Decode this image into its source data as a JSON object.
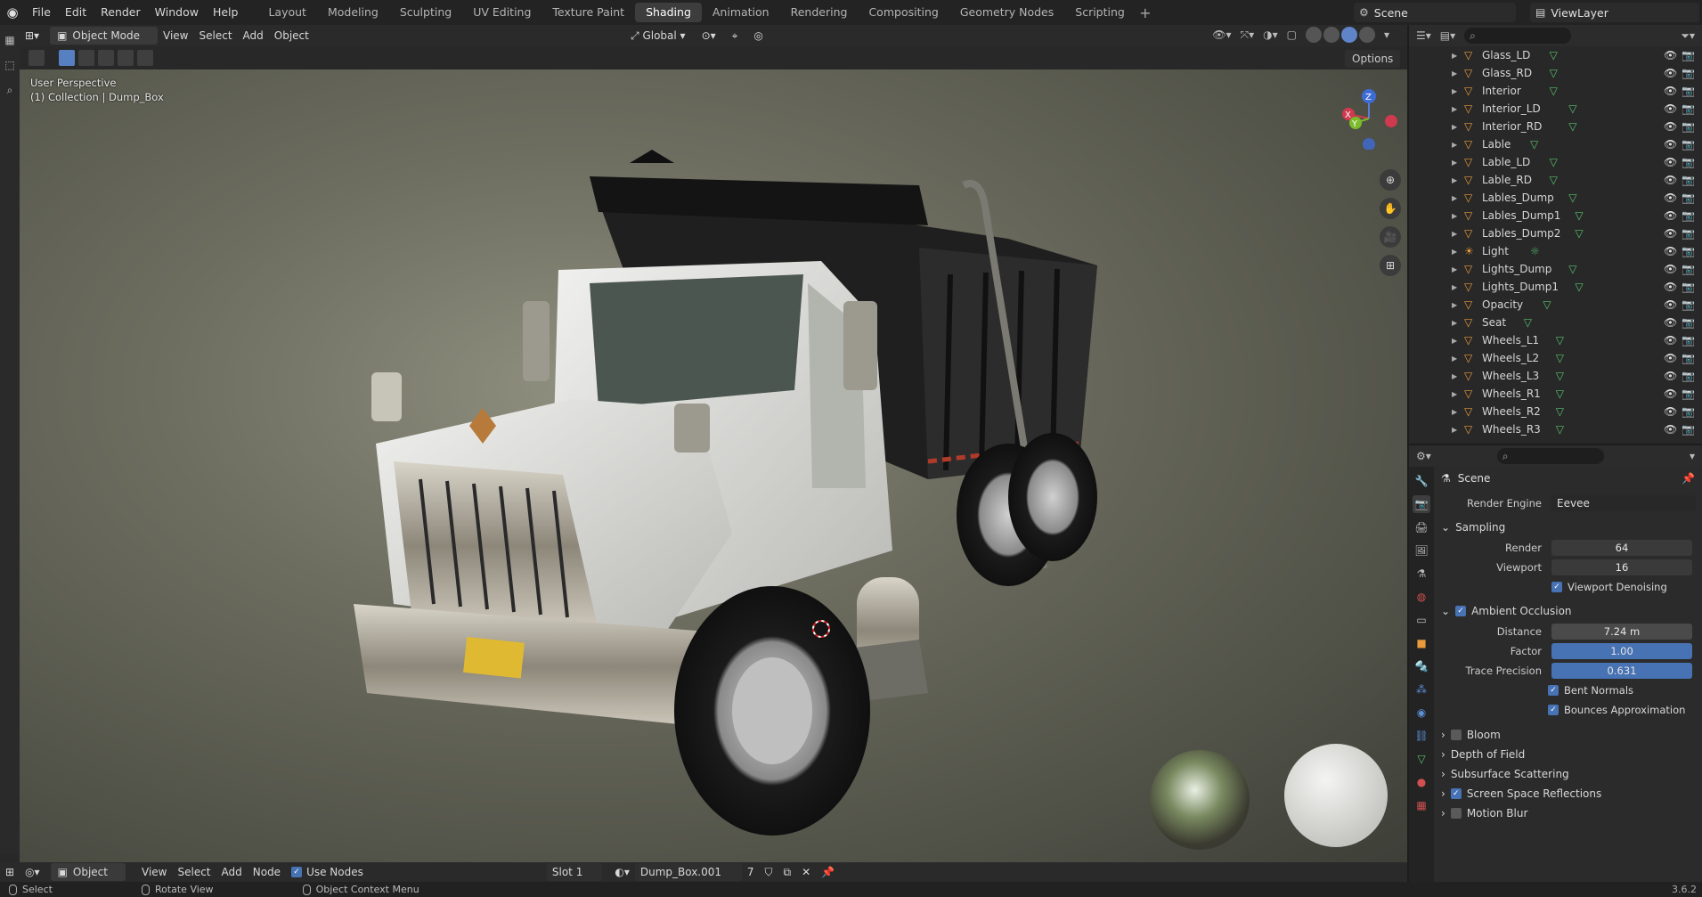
{
  "top_menu": {
    "items": [
      "File",
      "Edit",
      "Render",
      "Window",
      "Help"
    ],
    "workspaces": [
      "Layout",
      "Modeling",
      "Sculpting",
      "UV Editing",
      "Texture Paint",
      "Shading",
      "Animation",
      "Rendering",
      "Compositing",
      "Geometry Nodes",
      "Scripting"
    ],
    "active_workspace": "Shading",
    "scene_name": "Scene",
    "view_layer": "ViewLayer"
  },
  "viewport": {
    "mode": "Object Mode",
    "menus": [
      "View",
      "Select",
      "Add",
      "Object"
    ],
    "orientation": "Global",
    "options_label": "Options",
    "overlay_line1": "User Perspective",
    "overlay_line2": "(1) Collection | Dump_Box"
  },
  "node_editor": {
    "type": "Object",
    "menus": [
      "View",
      "Select",
      "Add",
      "Node"
    ],
    "use_nodes_label": "Use Nodes",
    "slot": "Slot 1",
    "material": "Dump_Box.001",
    "users": "7"
  },
  "outliner": {
    "items": [
      {
        "label": "Glass_LD",
        "type": "mesh"
      },
      {
        "label": "Glass_RD",
        "type": "mesh"
      },
      {
        "label": "Interior",
        "type": "mesh"
      },
      {
        "label": "Interior_LD",
        "type": "mesh"
      },
      {
        "label": "Interior_RD",
        "type": "mesh"
      },
      {
        "label": "Lable",
        "type": "mesh"
      },
      {
        "label": "Lable_LD",
        "type": "mesh"
      },
      {
        "label": "Lable_RD",
        "type": "mesh"
      },
      {
        "label": "Lables_Dump",
        "type": "mesh"
      },
      {
        "label": "Lables_Dump1",
        "type": "mesh"
      },
      {
        "label": "Lables_Dump2",
        "type": "mesh"
      },
      {
        "label": "Light",
        "type": "light"
      },
      {
        "label": "Lights_Dump",
        "type": "mesh"
      },
      {
        "label": "Lights_Dump1",
        "type": "mesh"
      },
      {
        "label": "Opacity",
        "type": "mesh"
      },
      {
        "label": "Seat",
        "type": "mesh"
      },
      {
        "label": "Wheels_L1",
        "type": "mesh"
      },
      {
        "label": "Wheels_L2",
        "type": "mesh"
      },
      {
        "label": "Wheels_L3",
        "type": "mesh"
      },
      {
        "label": "Wheels_R1",
        "type": "mesh"
      },
      {
        "label": "Wheels_R2",
        "type": "mesh"
      },
      {
        "label": "Wheels_R3",
        "type": "mesh"
      }
    ]
  },
  "properties": {
    "context": "Scene",
    "render_engine_label": "Render Engine",
    "render_engine": "Eevee",
    "sampling": {
      "title": "Sampling",
      "render_label": "Render",
      "render": "64",
      "viewport_label": "Viewport",
      "viewport": "16",
      "denoise_label": "Viewport Denoising"
    },
    "ao": {
      "title": "Ambient Occlusion",
      "distance_label": "Distance",
      "distance": "7.24 m",
      "factor_label": "Factor",
      "factor": "1.00",
      "trace_label": "Trace Precision",
      "trace": "0.631",
      "bent_label": "Bent Normals",
      "bounces_label": "Bounces Approximation"
    },
    "sections": [
      {
        "label": "Bloom",
        "checkbox": true,
        "checked": false
      },
      {
        "label": "Depth of Field",
        "checkbox": false
      },
      {
        "label": "Subsurface Scattering",
        "checkbox": false
      },
      {
        "label": "Screen Space Reflections",
        "checkbox": true,
        "checked": true
      },
      {
        "label": "Motion Blur",
        "checkbox": true,
        "checked": false
      }
    ]
  },
  "statusbar": {
    "select": "Select",
    "rotate": "Rotate View",
    "context_menu": "Object Context Menu",
    "version": "3.6.2"
  },
  "colors": {
    "accent_blue": "#4772b3",
    "object_orange": "#e89a3c",
    "mesh_green": "#57c26c"
  }
}
